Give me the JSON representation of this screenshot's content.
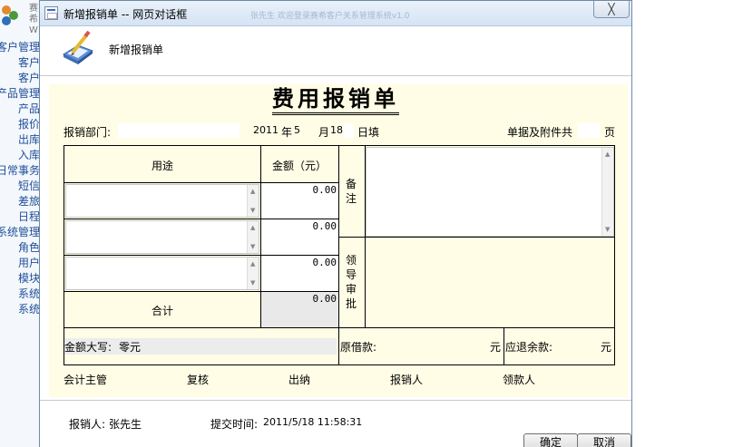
{
  "background_app": {
    "brand": "赛希",
    "brand2": "W",
    "menu": [
      {
        "label": "客户管理",
        "level": 1
      },
      {
        "label": "客户",
        "level": 2
      },
      {
        "label": "客户",
        "level": 2
      },
      {
        "label": "产品管理",
        "level": 1
      },
      {
        "label": "产品",
        "level": 2
      },
      {
        "label": "报价",
        "level": 2
      },
      {
        "label": "出库",
        "level": 2
      },
      {
        "label": "入库",
        "level": 2
      },
      {
        "label": "日常事务",
        "level": 1
      },
      {
        "label": "短信",
        "level": 2
      },
      {
        "label": "差旅",
        "level": 2
      },
      {
        "label": "日程",
        "level": 2
      },
      {
        "label": "系统管理",
        "level": 1
      },
      {
        "label": "角色",
        "level": 2
      },
      {
        "label": "用户",
        "level": 2
      },
      {
        "label": "模块",
        "level": 2
      },
      {
        "label": "系统",
        "level": 2
      },
      {
        "label": "系统",
        "level": 2
      }
    ]
  },
  "dialog": {
    "title": "新增报销单 -- 网页对话框",
    "title_bg_text": "张先生  欢迎登录赛希客户关系管理系统v1.0",
    "close_glyph": "╳",
    "header_title": "新增报销单"
  },
  "form": {
    "title": "费用报销单",
    "dept_label": "报销部门:",
    "dept_value": "",
    "year": "2011",
    "year_unit": "年",
    "month": "5",
    "month_unit": "月",
    "day": "18",
    "day_unit": "日填",
    "attach_label": "单据及附件共",
    "attach_count": "",
    "attach_unit": "页",
    "col_purpose": "用途",
    "col_amount": "金额（元）",
    "rows": [
      {
        "purpose": "",
        "amount": "0.00"
      },
      {
        "purpose": "",
        "amount": "0.00"
      },
      {
        "purpose": "",
        "amount": "0.00"
      }
    ],
    "total_label": "合计",
    "total_amount": "0.00",
    "remark_label": "备注",
    "approval_label": "领导审批",
    "amount_words_label": "金额大写:",
    "amount_words_value": "零元",
    "borrowed_label": "原借款:",
    "borrowed_unit": "元",
    "refund_label": "应退余款:",
    "refund_unit": "元",
    "signers": [
      "会计主管",
      "复核",
      "出纳",
      "报销人",
      "领款人"
    ]
  },
  "footer": {
    "reporter_label": "报销人:",
    "reporter_value": "张先生",
    "submit_label": "提交时间:",
    "submit_value": "2011/5/18 11:58:31",
    "ok_label": "确定",
    "cancel_label": "取消"
  }
}
